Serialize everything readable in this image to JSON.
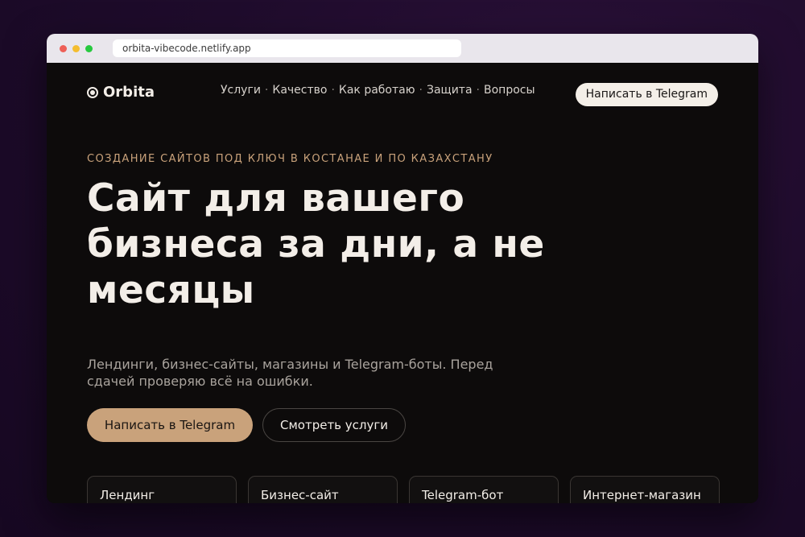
{
  "browser": {
    "url": "orbita-vibecode.netlify.app"
  },
  "header": {
    "logo_text": "Orbita",
    "logo_icon": "target-circle-icon",
    "nav": [
      "Услуги",
      "Качество",
      "Как работаю",
      "Защита",
      "Вопросы"
    ],
    "nav_separator": "·",
    "cta_label": "Написать в Telegram"
  },
  "hero": {
    "eyebrow": "СОЗДАНИЕ САЙТОВ ПОД КЛЮЧ В КОСТАНАЕ И ПО КАЗАХСТАНУ",
    "headline_lines": [
      "Сайт для вашего",
      "бизнеса за дни, а не",
      "месяцы"
    ],
    "subtitle": "Лендинги, бизнес-сайты, магазины и Telegram-боты. Перед сдачей проверяю всё на ошибки.",
    "primary_button": "Написать в Telegram",
    "secondary_button": "Смотреть услуги"
  },
  "services": [
    "Лендинг",
    "Бизнес-сайт",
    "Telegram-бот",
    "Интернет-магазин"
  ],
  "colors": {
    "accent": "#c9a27b",
    "page_background": "#0d0b0b",
    "text": "#f3eee8"
  }
}
